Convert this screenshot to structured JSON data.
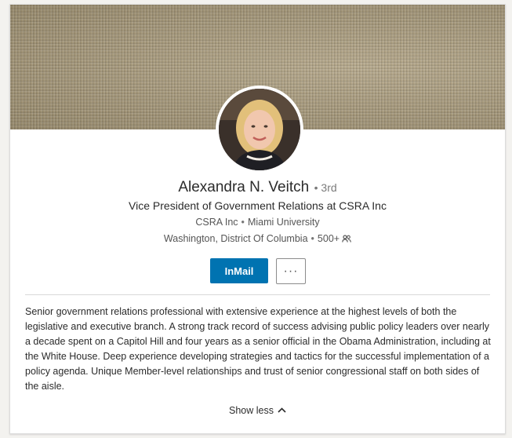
{
  "profile": {
    "name": "Alexandra N. Veitch",
    "degree": "• 3rd",
    "headline": "Vice President of Government Relations at CSRA Inc",
    "company": "CSRA Inc",
    "school": "Miami University",
    "location": "Washington, District Of Columbia",
    "connections": "500+",
    "connections_icon": "people-icon",
    "summary": "Senior government relations professional with extensive experience at the highest levels of both the legislative and executive branch. A strong track record of success advising public policy leaders over nearly a decade spent on a Capitol Hill and four years as a senior official in the Obama Administration, including at the White House. Deep experience developing strategies and tactics for the successful implementation of a policy agenda. Unique Member-level relationships and trust of senior congressional staff on both sides of the aisle."
  },
  "actions": {
    "inmail_label": "InMail",
    "more_label": "···",
    "more_icon": "more-dots-icon",
    "show_less_label": "Show less",
    "show_less_icon": "chevron-up-icon"
  },
  "colors": {
    "primary_button": "#0073b1",
    "card_background": "#ffffff",
    "page_background": "#f3f2ef"
  }
}
